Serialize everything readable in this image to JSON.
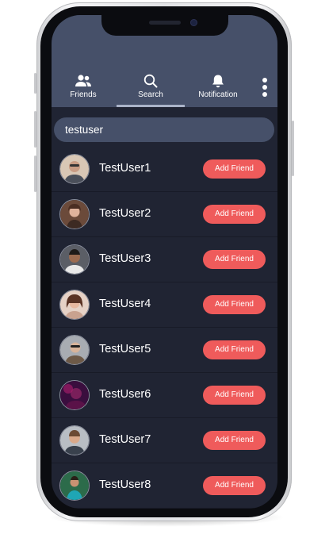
{
  "nav": {
    "tabs": [
      {
        "label": "Friends",
        "icon": "friends-icon"
      },
      {
        "label": "Search",
        "icon": "search-icon",
        "active": true
      },
      {
        "label": "Notification",
        "icon": "bell-icon"
      }
    ],
    "more_icon": "more-vertical-icon"
  },
  "search": {
    "value": "testuser"
  },
  "users": [
    {
      "name": "TestUser1",
      "action": "Add Friend",
      "avatar_bg": "#d9c7b5"
    },
    {
      "name": "TestUser2",
      "action": "Add Friend",
      "avatar_bg": "#6b4a3a"
    },
    {
      "name": "TestUser3",
      "action": "Add Friend",
      "avatar_bg": "#5b5e66"
    },
    {
      "name": "TestUser4",
      "action": "Add Friend",
      "avatar_bg": "#e6d2c6"
    },
    {
      "name": "TestUser5",
      "action": "Add Friend",
      "avatar_bg": "#a8acb2"
    },
    {
      "name": "TestUser6",
      "action": "Add Friend",
      "avatar_bg": "#3a0e3e"
    },
    {
      "name": "TestUser7",
      "action": "Add Friend",
      "avatar_bg": "#b9bec4"
    },
    {
      "name": "TestUser8",
      "action": "Add Friend",
      "avatar_bg": "#2c6b4a"
    }
  ],
  "colors": {
    "header_bg": "#465069",
    "screen_bg": "#202433",
    "accent_button": "#ef5b5b"
  }
}
